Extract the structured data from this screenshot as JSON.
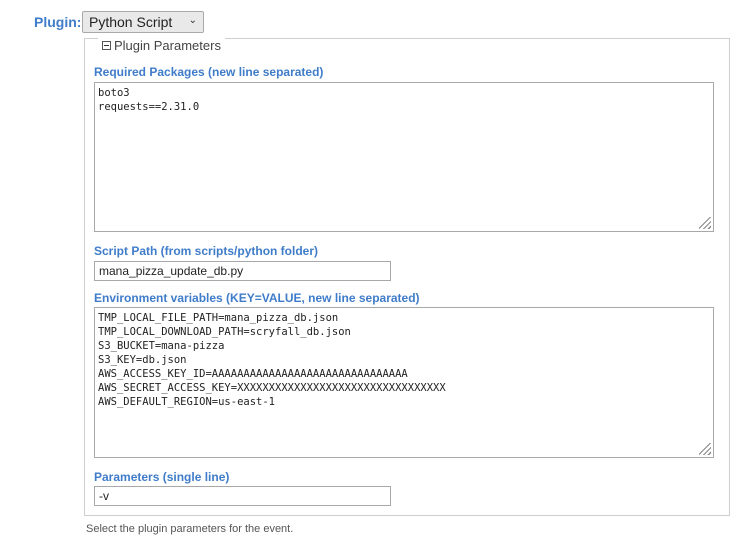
{
  "plugin": {
    "label": "Plugin:",
    "selected": "Python Script"
  },
  "params": {
    "legend": "Plugin Parameters",
    "packages": {
      "label": "Required Packages (new line separated)",
      "value": "boto3\nrequests==2.31.0"
    },
    "script_path": {
      "label": "Script Path (from scripts/python folder)",
      "value": "mana_pizza_update_db.py"
    },
    "env_vars": {
      "label": "Environment variables (KEY=VALUE, new line separated)",
      "value": "TMP_LOCAL_FILE_PATH=mana_pizza_db.json\nTMP_LOCAL_DOWNLOAD_PATH=scryfall_db.json\nS3_BUCKET=mana-pizza\nS3_KEY=db.json\nAWS_ACCESS_KEY_ID=AAAAAAAAAAAAAAAAAAAAAAAAAAAAAAA\nAWS_SECRET_ACCESS_KEY=XXXXXXXXXXXXXXXXXXXXXXXXXXXXXXXXX\nAWS_DEFAULT_REGION=us-east-1"
    },
    "parameters": {
      "label": "Parameters (single line)",
      "value": "-v"
    }
  },
  "help_text": "Select the plugin parameters for the event."
}
